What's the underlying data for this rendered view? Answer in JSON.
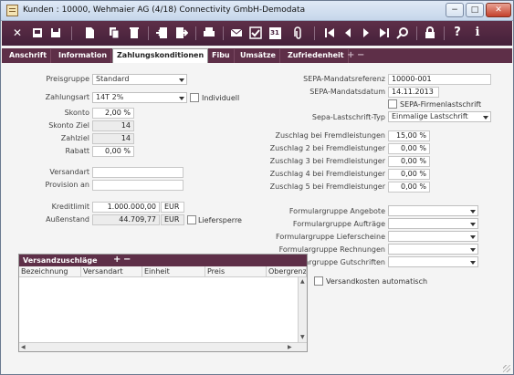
{
  "window": {
    "title": "Kunden : 10000, Wehmaier AG (4/18) Connectivity GmbH-Demodata",
    "controls": {
      "minimize": "−",
      "maximize": "□",
      "close": "✕"
    }
  },
  "toolbar": {
    "icons": [
      "close-icon",
      "new-icon",
      "save-icon",
      "document-dropdown-icon",
      "copy-icon",
      "delete-icon",
      "import-icon",
      "export-icon",
      "print-icon",
      "mail-icon",
      "check-icon",
      "calendar-icon",
      "attach-dropdown-icon",
      "first-icon",
      "prev-icon",
      "next-icon",
      "last-icon",
      "search-icon",
      "lock-icon",
      "help-icon",
      "info-icon"
    ],
    "calendar_label": "31"
  },
  "tabs": [
    {
      "label": "Anschrift",
      "active": false
    },
    {
      "label": "Information",
      "active": false
    },
    {
      "label": "Zahlungskonditionen",
      "active": true
    },
    {
      "label": "Fibu",
      "active": false
    },
    {
      "label": "Umsätze",
      "active": false
    },
    {
      "label": "Zufriedenheit",
      "active": false
    }
  ],
  "tab_controls": {
    "add": "+",
    "remove": "−"
  },
  "left": {
    "preisgruppe": {
      "label": "Preisgruppe",
      "value": "Standard"
    },
    "zahlungsart": {
      "label": "Zahlungsart",
      "value": "14T 2%",
      "individuell_label": "Individuell"
    },
    "skonto": {
      "label": "Skonto",
      "value": "2,00 %"
    },
    "skonto_ziel": {
      "label": "Skonto Ziel",
      "value": "14"
    },
    "zahlziel": {
      "label": "Zahlziel",
      "value": "14"
    },
    "rabatt": {
      "label": "Rabatt",
      "value": "0,00 %"
    },
    "versandart": {
      "label": "Versandart",
      "value": ""
    },
    "provision": {
      "label": "Provision an",
      "value": ""
    },
    "kreditlimit": {
      "label": "Kreditlimit",
      "value": "1.000.000,00",
      "currency": "EUR"
    },
    "aussenstand": {
      "label": "Außenstand",
      "value": "44.709,77",
      "currency": "EUR",
      "liefersperre_label": "Liefersperre"
    }
  },
  "right": {
    "sepa_ref": {
      "label": "SEPA-Mandatsreferenz",
      "value": "10000-001"
    },
    "sepa_datum": {
      "label": "SEPA-Mandatsdatum",
      "value": "14.11.2013"
    },
    "sepa_firmen_label": "SEPA-Firmenlastschrift",
    "sepa_typ": {
      "label": "Sepa-Lastschrift-Typ",
      "value": "Einmalige Lastschrift"
    },
    "zuschlaege": [
      {
        "label": "Zuschlag bei Fremdleistungen",
        "value": "15,00 %"
      },
      {
        "label": "Zuschlag 2 bei Fremdleistunger",
        "value": "0,00 %"
      },
      {
        "label": "Zuschlag 3 bei Fremdleistunger",
        "value": "0,00 %"
      },
      {
        "label": "Zuschlag 4 bei Fremdleistunger",
        "value": "0,00 %"
      },
      {
        "label": "Zuschlag 5 bei Fremdleistunger",
        "value": "0,00 %"
      }
    ],
    "formulargruppen": [
      {
        "label": "Formulargruppe Angebote",
        "value": ""
      },
      {
        "label": "Formulargruppe Aufträge",
        "value": ""
      },
      {
        "label": "Formulargruppe Lieferscheine",
        "value": ""
      },
      {
        "label": "Formulargruppe Rechnungen",
        "value": ""
      },
      {
        "label": "Formulargruppe Gutschriften",
        "value": ""
      }
    ],
    "versandkosten_label": "Versandkosten automatisch"
  },
  "versandzuschlaege": {
    "title": "Versandzuschläge",
    "add": "+",
    "remove": "−",
    "columns": [
      "Bezeichnung",
      "Versandart",
      "Einheit",
      "Preis",
      "Obergrenze"
    ]
  },
  "colors": {
    "accent": "#5e2f48",
    "toolbar": "#4a2440"
  }
}
